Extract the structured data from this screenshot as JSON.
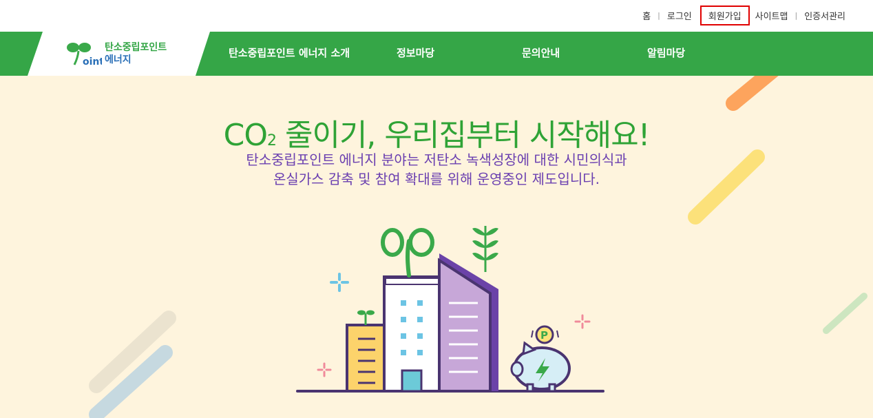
{
  "util_nav": {
    "home": "홈",
    "login": "로그인",
    "signup": "회원가입",
    "sitemap": "사이트맵",
    "cert": "인증서관리",
    "separator": "|"
  },
  "logo": {
    "line1": "탄소중립포인트",
    "line2": "에너지",
    "glyph": "oint"
  },
  "main_menu": [
    {
      "label": "탄소중립포인트 에너지 소개"
    },
    {
      "label": "정보마당"
    },
    {
      "label": "문의안내"
    },
    {
      "label": "알림마당"
    }
  ],
  "hero": {
    "headline_co": "CO",
    "headline_sub": "2",
    "headline_rest": " 줄이기, 우리집부터 시작해요!",
    "desc_line1": "탄소중립포인트 에너지 분야는 저탄소 녹색성장에 대한 시민의식과",
    "desc_line2": "온실가스 감축 및 참여 확대를 위해 운영중인 제도입니다.",
    "coin_letter": "P"
  },
  "colors": {
    "brand_green": "#35a647",
    "headline_green": "#2fa336",
    "desc_purple": "#6a3fb0",
    "hero_bg": "#fef4dd",
    "highlight_red": "#e00000"
  }
}
